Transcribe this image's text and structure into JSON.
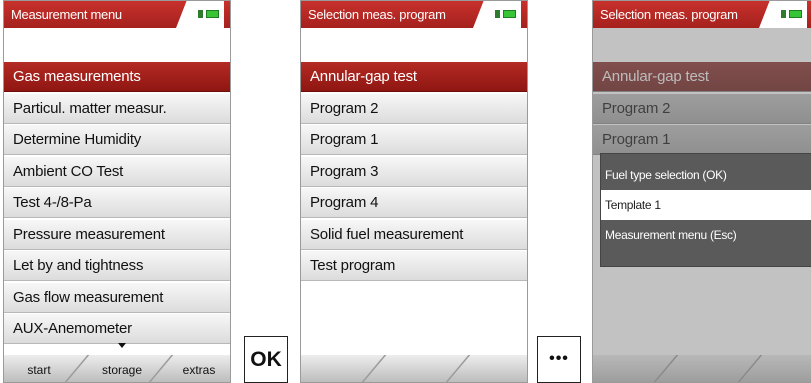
{
  "screen1": {
    "title": "Measurement menu",
    "items": [
      "Gas measurements",
      "Particul. matter measur.",
      "Determine Humidity",
      "Ambient CO Test",
      "Test 4-/8-Pa",
      "Pressure measurement",
      "Let by and tightness",
      "Gas flow measurement",
      "AUX-Anemometer"
    ],
    "softkeys": [
      "start",
      "storage",
      "extras"
    ]
  },
  "screen2": {
    "title": "Selection meas. program",
    "items": [
      "Annular-gap test",
      "Program 2",
      "Program 1",
      "Program 3",
      "Program 4",
      "Solid fuel measurement",
      "Test program"
    ]
  },
  "screen3": {
    "title": "Selection meas. program",
    "items": [
      "Annular-gap test",
      "Program 2",
      "Program 1"
    ],
    "popup": [
      "Fuel type selection (OK)",
      "Template 1",
      "Measurement menu (Esc)"
    ]
  },
  "buttons": {
    "ok": "OK",
    "more": "•••"
  },
  "colors": {
    "accent": "#b52a24",
    "battery": "#37c437"
  }
}
